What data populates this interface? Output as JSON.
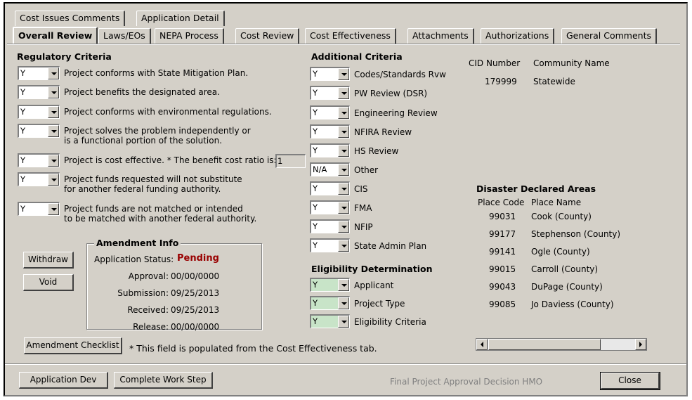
{
  "outer_tabs": [
    "Cost Issues Comments",
    "Application Detail"
  ],
  "inner_tabs": [
    "Overall Review",
    "Laws/EOs",
    "NEPA Process",
    "Cost Review",
    "Cost Effectiveness",
    "Attachments",
    "Authorizations",
    "General Comments"
  ],
  "regulatory": {
    "title": "Regulatory Criteria",
    "items": [
      {
        "value": "Y",
        "label1": "Project conforms with State Mitigation Plan.",
        "label2": ""
      },
      {
        "value": "Y",
        "label1": "Project benefits the designated area.",
        "label2": ""
      },
      {
        "value": "Y",
        "label1": "Project conforms with environmental regulations.",
        "label2": ""
      },
      {
        "value": "Y",
        "label1": "Project solves the problem independently or",
        "label2": "is a functional portion of the solution."
      },
      {
        "value": "Y",
        "label1": "Project is cost effective.  * The benefit cost ratio is:",
        "label2": ""
      },
      {
        "value": "Y",
        "label1": "Project funds requested will not substitute",
        "label2": "for another federal funding authority."
      },
      {
        "value": "Y",
        "label1": "Project funds are not matched or intended",
        "label2": "to be matched with another federal authority."
      }
    ],
    "bcr_value": "1"
  },
  "additional": {
    "title": "Additional Criteria",
    "items": [
      {
        "value": "Y",
        "label": "Codes/Standards Rvw"
      },
      {
        "value": "Y",
        "label": "PW Review (DSR)"
      },
      {
        "value": "Y",
        "label": "Engineering Review"
      },
      {
        "value": "Y",
        "label": "NFIRA Review"
      },
      {
        "value": "Y",
        "label": "HS Review"
      },
      {
        "value": "N/A",
        "label": "Other"
      },
      {
        "value": "Y",
        "label": "CIS"
      },
      {
        "value": "Y",
        "label": "FMA"
      },
      {
        "value": "Y",
        "label": "NFIP"
      },
      {
        "value": "Y",
        "label": "State Admin Plan"
      }
    ]
  },
  "eligibility": {
    "title": "Eligibility Determination",
    "items": [
      {
        "value": "Y",
        "label": "Applicant"
      },
      {
        "value": "Y",
        "label": "Project Type"
      },
      {
        "value": "Y",
        "label": "Eligibility Criteria"
      }
    ]
  },
  "cid": {
    "col1": "CID Number",
    "col2": "Community Name",
    "number": "179999",
    "name": "Statewide"
  },
  "disaster": {
    "title": "Disaster Declared Areas",
    "col1": "Place Code",
    "col2": "Place Name",
    "rows": [
      {
        "code": "99031",
        "name": "Cook (County)"
      },
      {
        "code": "99177",
        "name": "Stephenson (County)"
      },
      {
        "code": "99141",
        "name": "Ogle (County)"
      },
      {
        "code": "99015",
        "name": "Carroll (County)"
      },
      {
        "code": "99043",
        "name": "DuPage (County)"
      },
      {
        "code": "99085",
        "name": "Jo Daviess (County)"
      }
    ]
  },
  "amendment": {
    "title": "Amendment Info",
    "status_label": "Application Status:",
    "status_value": "Pending",
    "approval_label": "Approval:",
    "approval_value": "00/00/0000",
    "submission_label": "Submission:",
    "submission_value": "09/25/2013",
    "received_label": "Received:",
    "received_value": "09/25/2013",
    "release_label": "Release:",
    "release_value": "00/00/0000"
  },
  "buttons": {
    "withdraw": "Withdraw",
    "void": "Void",
    "amendment_checklist": "Amendment Checklist",
    "application_dev": "Application Dev",
    "complete_work_step": "Complete Work Step",
    "close": "Close"
  },
  "footnote": "* This field is populated from the Cost Effectiveness tab.",
  "decision_label": "Final Project Approval Decision  HMO",
  "colors": {
    "status": "#990000",
    "eligibility_combo": "#c8e4c8",
    "window": "#d4d0c8"
  }
}
